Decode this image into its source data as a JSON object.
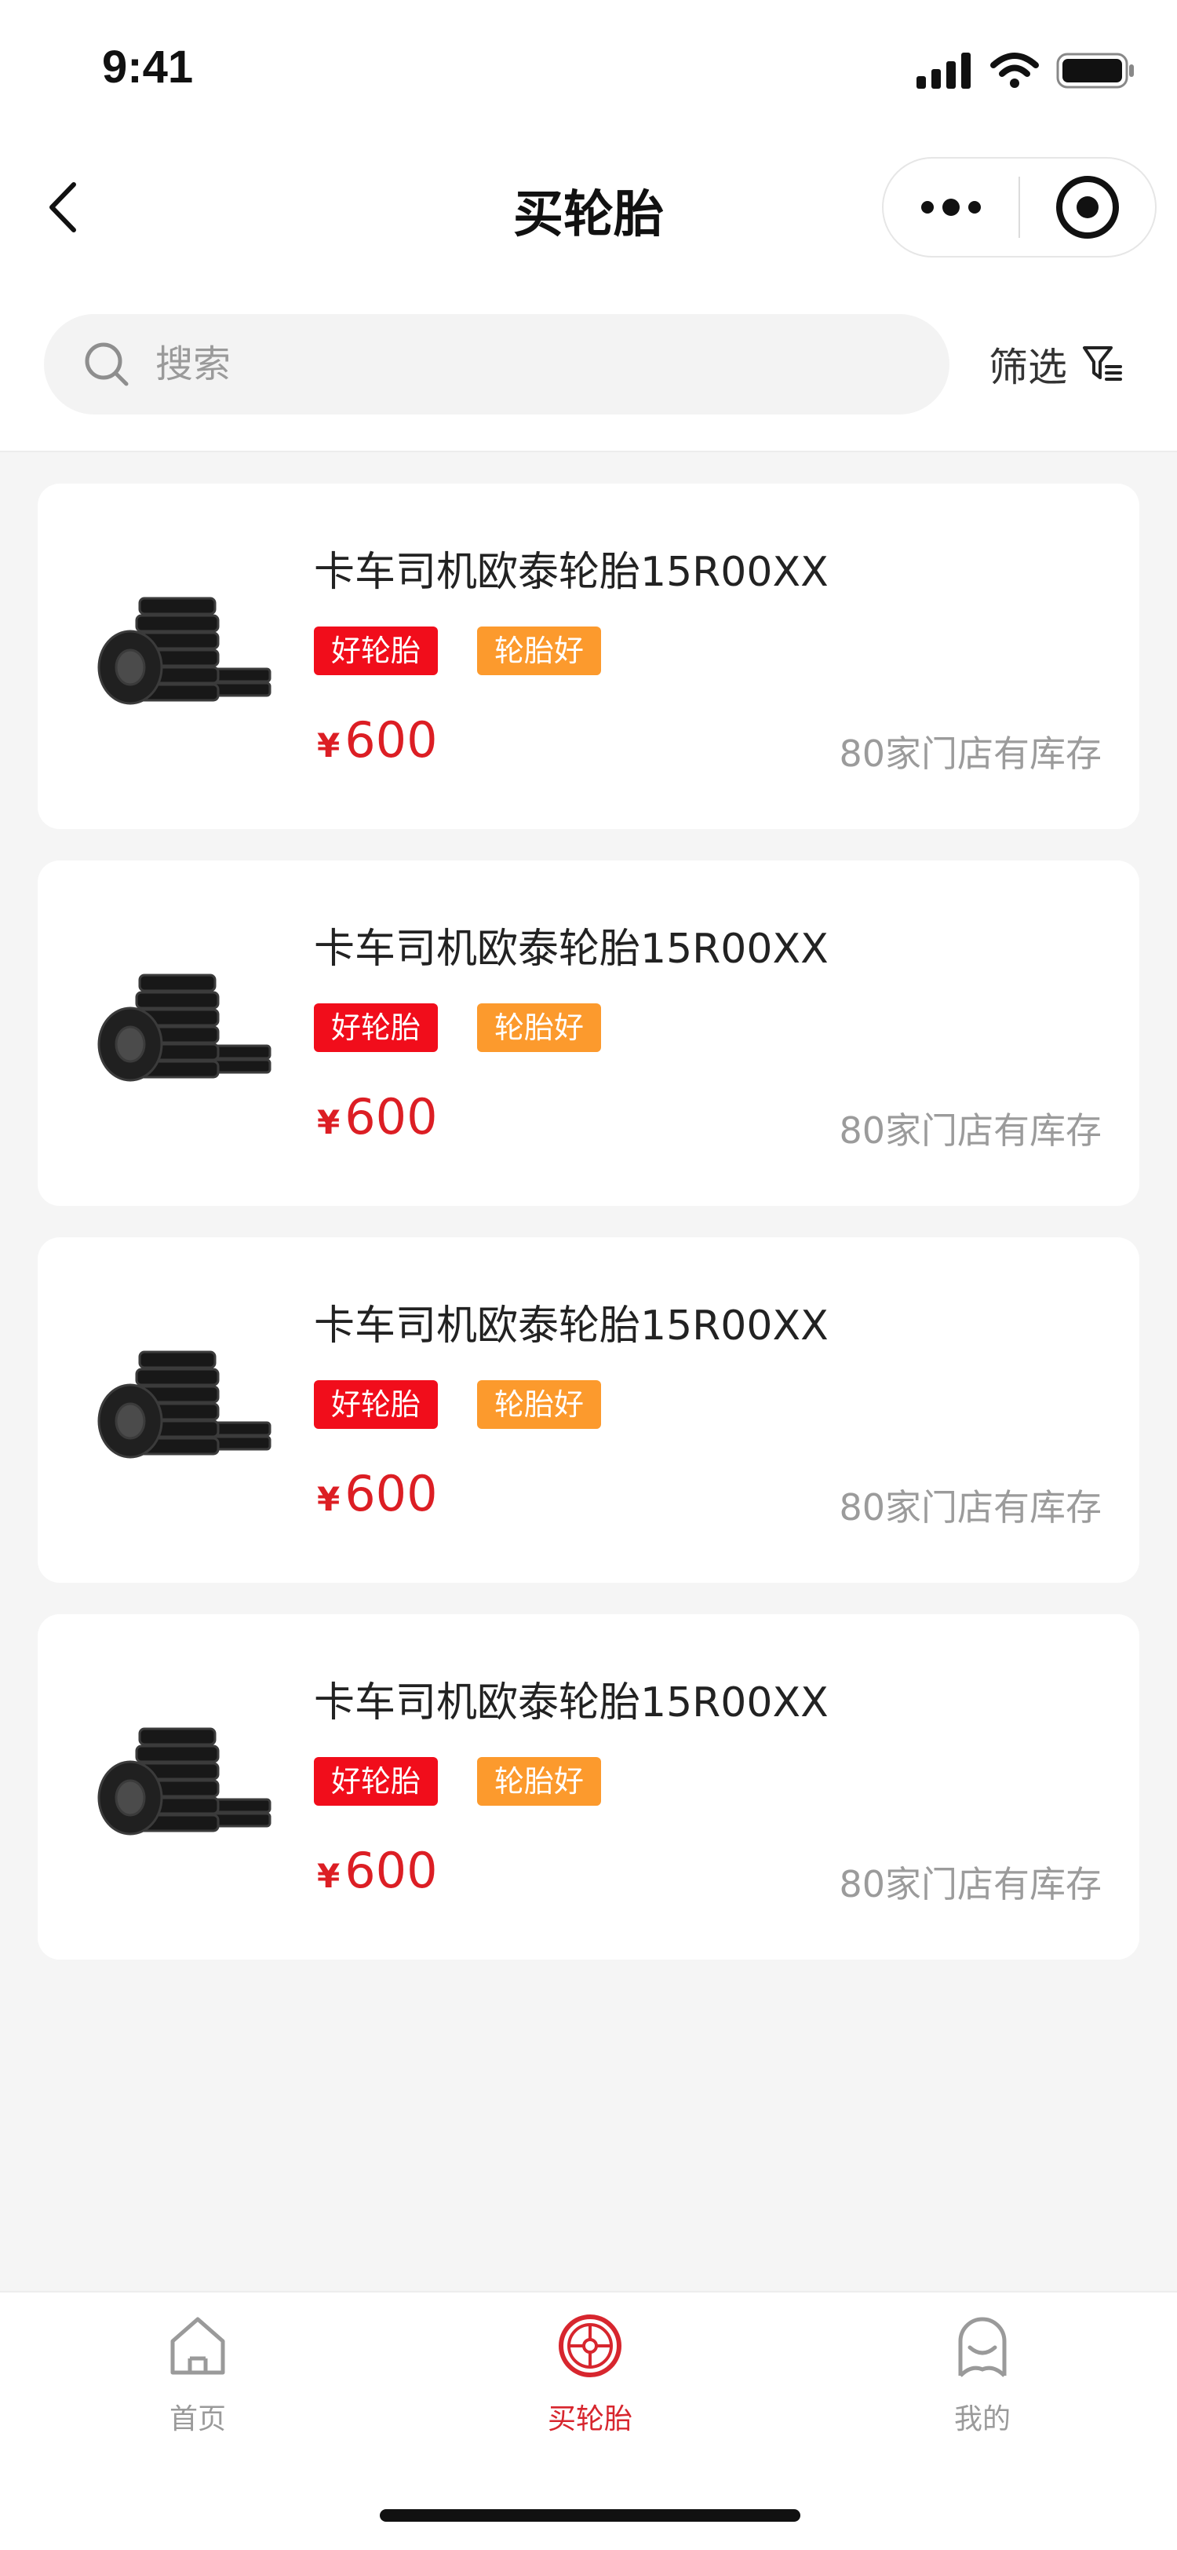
{
  "status_bar": {
    "time": "9:41"
  },
  "nav": {
    "title": "买轮胎"
  },
  "search": {
    "placeholder": "搜索"
  },
  "filter": {
    "label": "筛选"
  },
  "products": [
    {
      "name": "卡车司机欧泰轮胎15R00XX",
      "tags": [
        "好轮胎",
        "轮胎好"
      ],
      "currency": "¥",
      "price": "600",
      "stock": "80家门店有库存"
    },
    {
      "name": "卡车司机欧泰轮胎15R00XX",
      "tags": [
        "好轮胎",
        "轮胎好"
      ],
      "currency": "¥",
      "price": "600",
      "stock": "80家门店有库存"
    },
    {
      "name": "卡车司机欧泰轮胎15R00XX",
      "tags": [
        "好轮胎",
        "轮胎好"
      ],
      "currency": "¥",
      "price": "600",
      "stock": "80家门店有库存"
    },
    {
      "name": "卡车司机欧泰轮胎15R00XX",
      "tags": [
        "好轮胎",
        "轮胎好"
      ],
      "currency": "¥",
      "price": "600",
      "stock": "80家门店有库存"
    }
  ],
  "tabs": [
    {
      "label": "首页",
      "icon": "home-icon",
      "active": false
    },
    {
      "label": "买轮胎",
      "icon": "tire-icon",
      "active": true
    },
    {
      "label": "我的",
      "icon": "profile-icon",
      "active": false
    }
  ],
  "colors": {
    "accent_red": "#d7262e",
    "tag_red": "#f10d1b",
    "tag_orange": "#fc9a2d",
    "price_red": "#dc1e24",
    "muted_text": "#9b9b9b",
    "page_background": "#f5f5f5"
  }
}
